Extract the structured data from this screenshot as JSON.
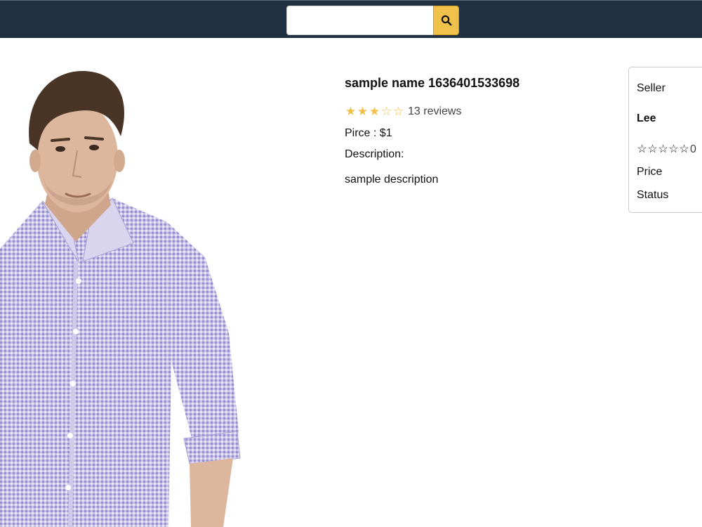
{
  "search": {
    "value": "",
    "placeholder": "",
    "button_icon": "search-icon"
  },
  "product": {
    "name": "sample name 1636401533698",
    "rating": 3,
    "rating_max": 5,
    "reviews_text": "13 reviews",
    "price_text": "Pirce : $1",
    "description_label": "Description:",
    "description": "sample description",
    "image_alt": "product-photo"
  },
  "seller": {
    "heading": "Seller",
    "name": "Lee",
    "rating": 0,
    "rating_max": 5,
    "rating_count_text": "0",
    "price_label": "Price",
    "status_label": "Status"
  },
  "colors": {
    "header_bg": "#203040",
    "accent": "#f0c14b",
    "seller_link": "#1414a8"
  }
}
